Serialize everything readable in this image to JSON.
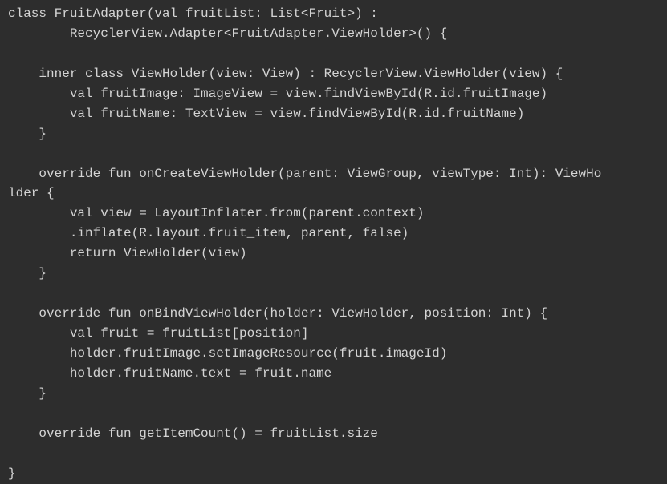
{
  "code_lines": [
    "class FruitAdapter(val fruitList: List<Fruit>) :",
    "        RecyclerView.Adapter<FruitAdapter.ViewHolder>() {",
    "",
    "    inner class ViewHolder(view: View) : RecyclerView.ViewHolder(view) {",
    "        val fruitImage: ImageView = view.findViewById(R.id.fruitImage)",
    "        val fruitName: TextView = view.findViewById(R.id.fruitName)",
    "    }",
    "",
    "    override fun onCreateViewHolder(parent: ViewGroup, viewType: Int): ViewHo",
    "lder {",
    "        val view = LayoutInflater.from(parent.context)",
    "        .inflate(R.layout.fruit_item, parent, false)",
    "        return ViewHolder(view)",
    "    }",
    "",
    "    override fun onBindViewHolder(holder: ViewHolder, position: Int) {",
    "        val fruit = fruitList[position]",
    "        holder.fruitImage.setImageResource(fruit.imageId)",
    "        holder.fruitName.text = fruit.name",
    "    }",
    "",
    "    override fun getItemCount() = fruitList.size",
    "",
    "}"
  ],
  "colors": {
    "background": "#2d2d2d",
    "text": "#d4d4d4"
  }
}
